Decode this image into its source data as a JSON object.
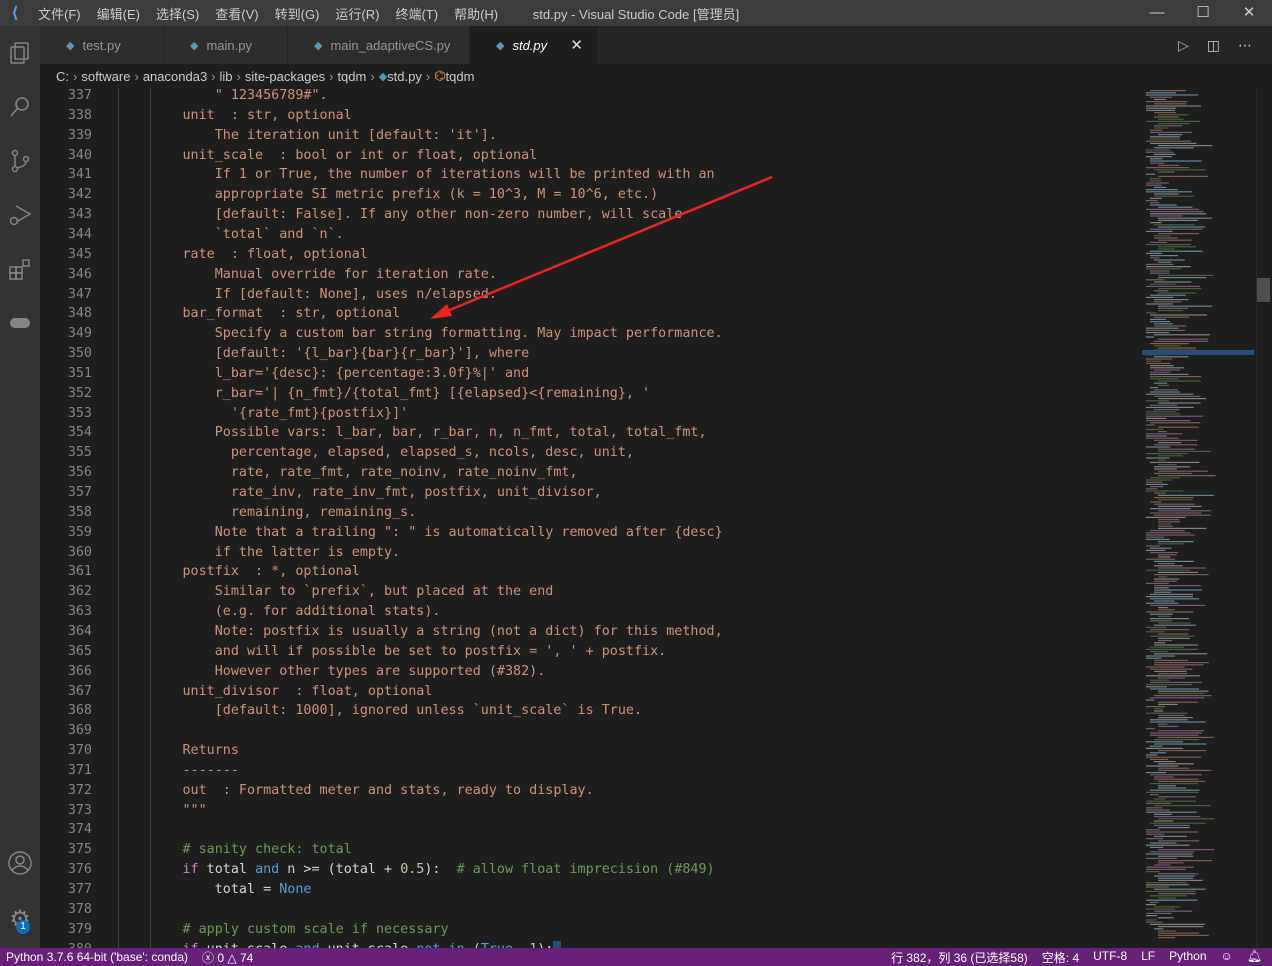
{
  "titlebar": {
    "title": "std.py - Visual Studio Code [管理员]",
    "menu": [
      "文件(F)",
      "编辑(E)",
      "选择(S)",
      "查看(V)",
      "转到(G)",
      "运行(R)",
      "终端(T)",
      "帮助(H)"
    ]
  },
  "activity": [
    "files-icon",
    "search-icon",
    "source-control-icon",
    "run-debug-icon",
    "extensions-icon",
    "remote-gamepad-icon"
  ],
  "accounts_badge": "1",
  "tabs": [
    {
      "label": "test.py"
    },
    {
      "label": "main.py"
    },
    {
      "label": "main_adaptiveCS.py"
    },
    {
      "label": "std.py",
      "active": true
    }
  ],
  "breadcrumb": [
    "C:",
    "software",
    "anaconda3",
    "lib",
    "site-packages",
    "tqdm",
    "std.py",
    "tqdm"
  ],
  "code": [
    {
      "n": "337",
      "t": [
        [
          "            \" 123456789#\".",
          "str"
        ]
      ]
    },
    {
      "n": "338",
      "t": [
        [
          "        unit  : str, optional",
          "str"
        ]
      ]
    },
    {
      "n": "339",
      "t": [
        [
          "            The iteration unit [default: 'it'].",
          "str"
        ]
      ]
    },
    {
      "n": "340",
      "t": [
        [
          "        unit_scale  : bool or int or float, optional",
          "str"
        ]
      ]
    },
    {
      "n": "341",
      "t": [
        [
          "            If 1 or True, the number of iterations will be printed with an",
          "str"
        ]
      ]
    },
    {
      "n": "342",
      "t": [
        [
          "            appropriate SI metric prefix (k = 10^3, M = 10^6, etc.)",
          "str"
        ]
      ]
    },
    {
      "n": "343",
      "t": [
        [
          "            [default: False]. If any other non-zero number, will scale",
          "str"
        ]
      ]
    },
    {
      "n": "344",
      "t": [
        [
          "            `total` and `n`.",
          "str"
        ]
      ]
    },
    {
      "n": "345",
      "t": [
        [
          "        rate  : float, optional",
          "str"
        ]
      ]
    },
    {
      "n": "346",
      "t": [
        [
          "            Manual override for iteration rate.",
          "str"
        ]
      ]
    },
    {
      "n": "347",
      "t": [
        [
          "            If [default: None], uses n/elapsed.",
          "str"
        ]
      ]
    },
    {
      "n": "348",
      "t": [
        [
          "        bar_format  : str, optional",
          "str"
        ]
      ]
    },
    {
      "n": "349",
      "t": [
        [
          "            Specify a custom bar string formatting. May impact performance.",
          "str"
        ]
      ]
    },
    {
      "n": "350",
      "t": [
        [
          "            [default: '{l_bar}{bar}{r_bar}'], where",
          "str"
        ]
      ]
    },
    {
      "n": "351",
      "t": [
        [
          "            l_bar='{desc}: {percentage:3.0f}%|' and",
          "str"
        ]
      ]
    },
    {
      "n": "352",
      "t": [
        [
          "            r_bar='| {n_fmt}/{total_fmt} [{elapsed}<{remaining}, '",
          "str"
        ]
      ]
    },
    {
      "n": "353",
      "t": [
        [
          "              '{rate_fmt}{postfix}]'",
          "str"
        ]
      ]
    },
    {
      "n": "354",
      "t": [
        [
          "            Possible vars: l_bar, bar, r_bar, n, n_fmt, total, total_fmt,",
          "str"
        ]
      ]
    },
    {
      "n": "355",
      "t": [
        [
          "              percentage, elapsed, elapsed_s, ncols, desc, unit,",
          "str"
        ]
      ]
    },
    {
      "n": "356",
      "t": [
        [
          "              rate, rate_fmt, rate_noinv, rate_noinv_fmt,",
          "str"
        ]
      ]
    },
    {
      "n": "357",
      "t": [
        [
          "              rate_inv, rate_inv_fmt, postfix, unit_divisor,",
          "str"
        ]
      ]
    },
    {
      "n": "358",
      "t": [
        [
          "              remaining, remaining_s.",
          "str"
        ]
      ]
    },
    {
      "n": "359",
      "t": [
        [
          "            Note that a trailing \": \" is automatically removed after {desc}",
          "str"
        ]
      ]
    },
    {
      "n": "360",
      "t": [
        [
          "            if the latter is empty.",
          "str"
        ]
      ]
    },
    {
      "n": "361",
      "t": [
        [
          "        postfix  : *, optional",
          "str"
        ]
      ]
    },
    {
      "n": "362",
      "t": [
        [
          "            Similar to `prefix`, but placed at the end",
          "str"
        ]
      ]
    },
    {
      "n": "363",
      "t": [
        [
          "            (e.g. for additional stats).",
          "str"
        ]
      ]
    },
    {
      "n": "364",
      "t": [
        [
          "            Note: postfix is usually a string (not a dict) for this method,",
          "str"
        ]
      ]
    },
    {
      "n": "365",
      "t": [
        [
          "            and will if possible be set to postfix = ', ' + postfix.",
          "str"
        ]
      ]
    },
    {
      "n": "366",
      "t": [
        [
          "            However other types are supported (#382).",
          "str"
        ]
      ]
    },
    {
      "n": "367",
      "t": [
        [
          "        unit_divisor  : float, optional",
          "str"
        ]
      ]
    },
    {
      "n": "368",
      "t": [
        [
          "            [default: 1000], ignored unless `unit_scale` is True.",
          "str"
        ]
      ]
    },
    {
      "n": "369",
      "t": []
    },
    {
      "n": "370",
      "t": [
        [
          "        Returns",
          "str"
        ]
      ]
    },
    {
      "n": "371",
      "t": [
        [
          "        -------",
          "str"
        ]
      ]
    },
    {
      "n": "372",
      "t": [
        [
          "        out  : Formatted meter and stats, ready to display.",
          "str"
        ]
      ]
    },
    {
      "n": "373",
      "t": [
        [
          "        \"\"\"",
          "str"
        ]
      ]
    },
    {
      "n": "374",
      "t": []
    },
    {
      "n": "375",
      "t": [
        [
          "        # sanity check: total",
          "cm"
        ]
      ]
    },
    {
      "n": "376",
      "t": [
        [
          "        ",
          "tx"
        ],
        [
          "if",
          "kw"
        ],
        [
          " total ",
          "tx"
        ],
        [
          "and",
          "op"
        ],
        [
          " n >= (total + ",
          "tx"
        ],
        [
          "0.5",
          "nm"
        ],
        [
          "):  ",
          "tx"
        ],
        [
          "# allow float imprecision (#849)",
          "cm"
        ]
      ]
    },
    {
      "n": "377",
      "t": [
        [
          "            total = ",
          "tx"
        ],
        [
          "None",
          "op"
        ]
      ]
    },
    {
      "n": "378",
      "t": []
    },
    {
      "n": "379",
      "t": [
        [
          "        # apply custom scale if necessary",
          "cm"
        ]
      ]
    },
    {
      "n": "380",
      "t": [
        [
          "        ",
          "tx"
        ],
        [
          "if",
          "kw"
        ],
        [
          " unit_scale ",
          "tx"
        ],
        [
          "and",
          "op"
        ],
        [
          " unit_scale ",
          "tx"
        ],
        [
          "not in",
          "op"
        ],
        [
          " (",
          "tx"
        ],
        [
          "True",
          "op"
        ],
        [
          ", ",
          "tx"
        ],
        [
          "1",
          "nm"
        ],
        [
          "):",
          "tx"
        ]
      ]
    }
  ],
  "status": {
    "interpreter": "Python 3.7.6 64-bit ('base': conda)",
    "errors": "0",
    "warnings": "74",
    "position": "行 382，列 36 (已选择58)",
    "indent": "空格: 4",
    "encoding": "UTF-8",
    "eol": "LF",
    "language": "Python"
  },
  "colors": {
    "statusbar": "#68217a",
    "arrow": "#e8251f",
    "string": "#ce9178",
    "comment": "#6a9955"
  }
}
